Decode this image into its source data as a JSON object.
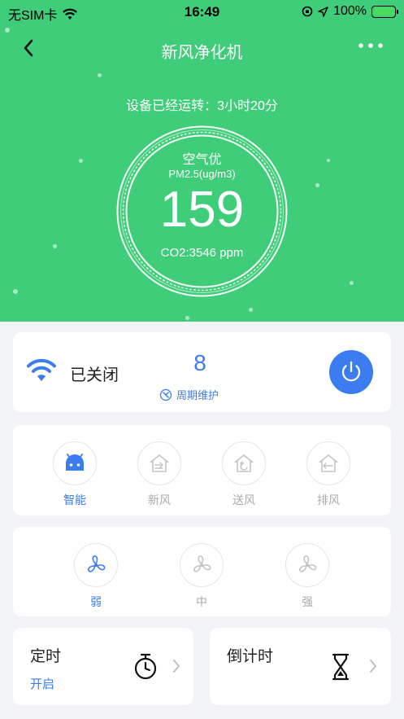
{
  "status_bar": {
    "carrier": "无SIM卡",
    "time": "16:49",
    "battery": "100%"
  },
  "nav": {
    "title": "新风净化机"
  },
  "hero": {
    "runtime": "设备已经运转：3小时20分",
    "air_quality": "空气优",
    "pm_unit": "PM2.5(ug/m3)",
    "pm_value": "159",
    "co2": "CO2:3546 ppm"
  },
  "device": {
    "state": "已关闭",
    "maintenance_count": "8",
    "maintenance_label": "周期维护"
  },
  "modes": [
    {
      "label": "智能",
      "icon": "android-robot-icon",
      "active": true
    },
    {
      "label": "新风",
      "icon": "house-fresh-air-icon",
      "active": false
    },
    {
      "label": "送风",
      "icon": "house-supply-air-icon",
      "active": false
    },
    {
      "label": "排风",
      "icon": "house-exhaust-icon",
      "active": false
    }
  ],
  "speeds": [
    {
      "label": "弱",
      "icon": "fan-icon",
      "active": true
    },
    {
      "label": "中",
      "icon": "fan-icon",
      "active": false
    },
    {
      "label": "强",
      "icon": "fan-icon",
      "active": false
    }
  ],
  "timer": {
    "title": "定时",
    "status": "开启",
    "icon": "stopwatch-icon"
  },
  "countdown": {
    "title": "倒计时",
    "icon": "hourglass-icon"
  },
  "colors": {
    "hero_green": "#3fcd79",
    "accent_blue": "#3b7cf0",
    "inactive_gray": "#aaaaaa"
  }
}
